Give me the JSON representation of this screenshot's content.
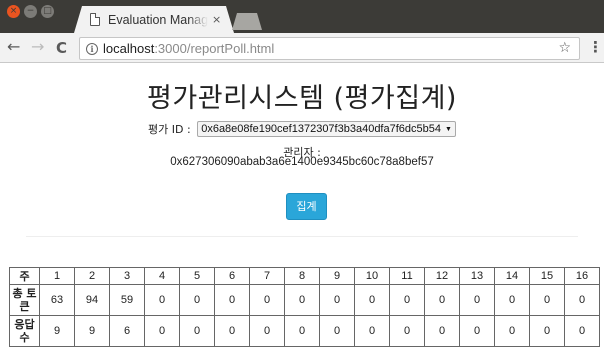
{
  "browser": {
    "tab_title": "Evaluation Manage",
    "tab_close": "×",
    "url_host": "localhost",
    "url_path": ":3000/reportPoll.html",
    "star_icon": "☆",
    "menu_icon": "⋮",
    "back_icon": "←",
    "forward_icon": "→",
    "reload_icon": "C",
    "info_icon": "i",
    "window_controls": {
      "close": "×",
      "minimize": "−",
      "maximize": "□"
    },
    "colors": {
      "titlebar": "#3c3b37",
      "close": "#e95420",
      "toolbar": "#f2f2f2"
    }
  },
  "page": {
    "title": "평가관리시스템 (평가집계)",
    "poll_label": "평가 ID :",
    "poll_selected": "0x6a8e08fe190cef1372307f3b3a40dfa7f6dc5b54",
    "admin_label": "관리자 :",
    "admin_address": "0x627306090abab3a6e1400e9345bc60c78a8bef57",
    "tally_button": "집계",
    "accent_color": "#2aa6d9"
  },
  "results": {
    "header_label": "주",
    "columns": [
      "1",
      "2",
      "3",
      "4",
      "5",
      "6",
      "7",
      "8",
      "9",
      "10",
      "11",
      "12",
      "13",
      "14",
      "15",
      "16"
    ],
    "rows": [
      {
        "label": "총 토큰",
        "values": [
          "63",
          "94",
          "59",
          "0",
          "0",
          "0",
          "0",
          "0",
          "0",
          "0",
          "0",
          "0",
          "0",
          "0",
          "0",
          "0"
        ]
      },
      {
        "label": "응답수",
        "values": [
          "9",
          "9",
          "6",
          "0",
          "0",
          "0",
          "0",
          "0",
          "0",
          "0",
          "0",
          "0",
          "0",
          "0",
          "0",
          "0"
        ]
      }
    ]
  }
}
